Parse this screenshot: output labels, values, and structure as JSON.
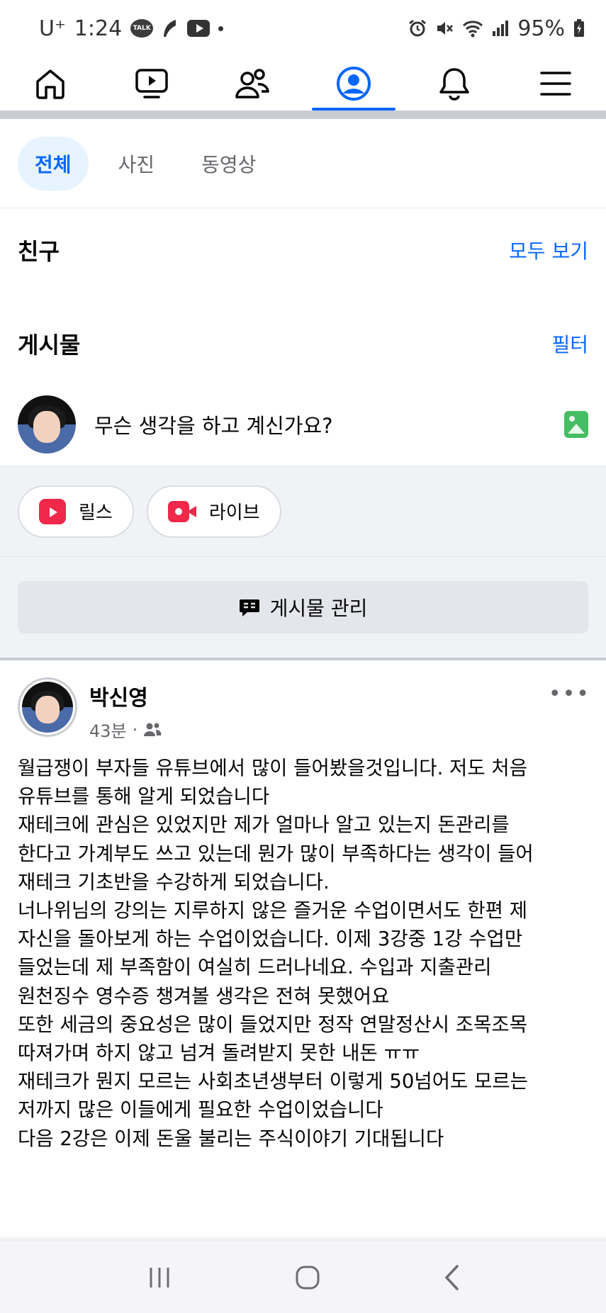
{
  "status_bar": {
    "carrier": "U⁺",
    "time": "1:24",
    "talk_badge": "TALK",
    "battery": "95%",
    "icons": [
      "talk-icon",
      "feather-icon",
      "youtube-icon",
      "alarm-icon",
      "mute-icon",
      "wifi-icon",
      "signal-icon",
      "battery-icon"
    ]
  },
  "top_nav": {
    "items": [
      "home-icon",
      "video-icon",
      "friends-icon",
      "profile-icon",
      "bell-icon",
      "menu-icon"
    ],
    "active_index": 3,
    "accent": "#0866ff"
  },
  "filter_chips": [
    {
      "label": "전체",
      "active": true
    },
    {
      "label": "사진",
      "active": false
    },
    {
      "label": "동영상",
      "active": false
    }
  ],
  "friends_section": {
    "title": "친구",
    "link": "모두 보기"
  },
  "posts_section": {
    "title": "게시물",
    "link": "필터"
  },
  "composer": {
    "placeholder": "무슨 생각을 하고 계신가요?"
  },
  "quick_actions": {
    "reels": "릴스",
    "live": "라이브"
  },
  "manage_posts": {
    "label": "게시물 관리"
  },
  "post": {
    "author": "박신영",
    "time": "43분",
    "separator": "·",
    "more": "•••",
    "lines": [
      "월급쟁이 부자들 유튜브에서 많이 들어봤을것입니다. 저도 처음",
      "유튜브를 통해 알게 되었습니다",
      "재테크에 관심은 있었지만 제가 얼마나 알고 있는지 돈관리를",
      "한다고 가계부도 쓰고 있는데 뭔가 많이 부족하다는 생각이 들어",
      "재테크 기초반을 수강하게 되었습니다.",
      "너나위님의 강의는 지루하지 않은 즐거운 수업이면서도 한편 제",
      "자신을 돌아보게 하는 수업이었습니다. 이제 3강중 1강 수업만",
      "들었는데 제 부족함이 여실히 드러나네요. 수입과 지출관리",
      "원천징수 영수증 챙겨볼 생각은 전혀 못했어요",
      "또한 세금의 중요성은 많이 들었지만 정작 연말정산시 조목조목",
      "따져가며 하지 않고 넘겨 돌려받지 못한 내돈 ㅠㅠ",
      "재테크가 뭔지 모르는 사회초년생부터 이렇게 50넘어도 모르는",
      "저까지 많은 이들에게 필요한 수업이었습니다",
      "다음 2강은 이제  돈울 불리는 주식이야기 기대됩니다"
    ]
  },
  "system_nav": {
    "items": [
      "recents-icon",
      "home-circle-icon",
      "back-icon"
    ]
  }
}
